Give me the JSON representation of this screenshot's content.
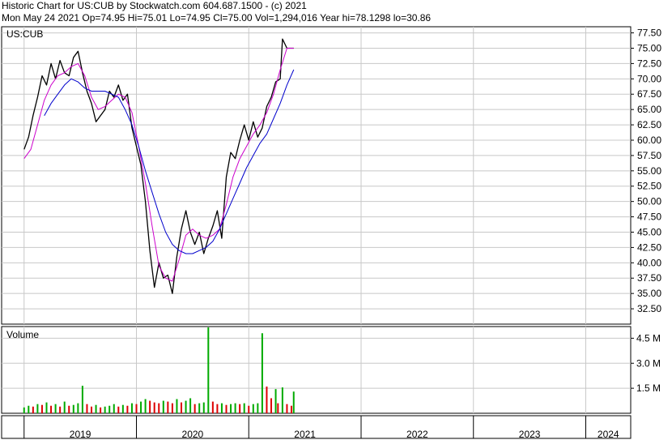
{
  "header": {
    "line1": "Historic Chart for US:CUB by Stockwatch.com 604.687.1500 - (c) 2021",
    "line2": "Mon May 24 2021   Op=74.95   Hi=75.01   Lo=74.95   Cl=75.00   Vol=1,294,016   Year hi=78.1298   lo=30.86"
  },
  "colors": {
    "price": "#000000",
    "ma_short": "#cc00cc",
    "ma_long": "#0000cc",
    "vol_up": "#00aa00",
    "vol_down": "#dd0000",
    "grid": "#c8c8c8"
  },
  "chart_data": [
    {
      "type": "line",
      "label": "US:CUB",
      "y_ticks": [
        "77.50",
        "75.00",
        "72.50",
        "70.00",
        "67.50",
        "65.00",
        "62.50",
        "60.00",
        "57.50",
        "55.00",
        "52.50",
        "50.00",
        "47.50",
        "45.00",
        "42.50",
        "40.00",
        "37.50",
        "35.00",
        "32.50"
      ],
      "ylim": [
        30.0,
        78.5
      ],
      "x_ticks": [
        "2019",
        "2020",
        "2021",
        "2022",
        "2023",
        "2024"
      ],
      "series": [
        {
          "values": [
            [
              2019.0,
              58.5
            ],
            [
              2019.04,
              60.5
            ],
            [
              2019.08,
              64.0
            ],
            [
              2019.12,
              67.0
            ],
            [
              2019.16,
              70.5
            ],
            [
              2019.2,
              69.0
            ],
            [
              2019.24,
              72.5
            ],
            [
              2019.28,
              70.0
            ],
            [
              2019.32,
              73.0
            ],
            [
              2019.36,
              71.0
            ],
            [
              2019.4,
              70.5
            ],
            [
              2019.44,
              73.5
            ],
            [
              2019.48,
              74.5
            ],
            [
              2019.52,
              71.0
            ],
            [
              2019.56,
              68.0
            ],
            [
              2019.6,
              66.0
            ],
            [
              2019.64,
              63.0
            ],
            [
              2019.68,
              64.0
            ],
            [
              2019.72,
              65.0
            ],
            [
              2019.76,
              68.0
            ],
            [
              2019.8,
              67.0
            ],
            [
              2019.84,
              69.0
            ],
            [
              2019.88,
              66.5
            ],
            [
              2019.92,
              67.5
            ],
            [
              2019.96,
              62.0
            ],
            [
              2020.0,
              59.0
            ],
            [
              2020.04,
              56.0
            ],
            [
              2020.08,
              50.0
            ],
            [
              2020.12,
              42.0
            ],
            [
              2020.16,
              36.0
            ],
            [
              2020.2,
              40.0
            ],
            [
              2020.24,
              37.5
            ],
            [
              2020.28,
              38.0
            ],
            [
              2020.32,
              35.0
            ],
            [
              2020.36,
              41.0
            ],
            [
              2020.4,
              45.5
            ],
            [
              2020.44,
              48.5
            ],
            [
              2020.48,
              45.0
            ],
            [
              2020.52,
              43.0
            ],
            [
              2020.56,
              45.0
            ],
            [
              2020.6,
              41.5
            ],
            [
              2020.64,
              44.0
            ],
            [
              2020.68,
              46.0
            ],
            [
              2020.72,
              48.5
            ],
            [
              2020.76,
              44.0
            ],
            [
              2020.8,
              54.0
            ],
            [
              2020.84,
              58.0
            ],
            [
              2020.88,
              57.0
            ],
            [
              2020.92,
              60.0
            ],
            [
              2020.96,
              62.5
            ],
            [
              2021.0,
              60.0
            ],
            [
              2021.04,
              63.0
            ],
            [
              2021.08,
              60.5
            ],
            [
              2021.12,
              62.0
            ],
            [
              2021.16,
              65.5
            ],
            [
              2021.2,
              67.0
            ],
            [
              2021.24,
              69.5
            ],
            [
              2021.28,
              70.0
            ],
            [
              2021.3,
              76.5
            ],
            [
              2021.34,
              75.0
            ],
            [
              2021.38,
              75.0
            ],
            [
              2021.4,
              75.0
            ]
          ]
        },
        {
          "name": "",
          "values": [
            [
              2019.0,
              57.0
            ],
            [
              2019.06,
              58.5
            ],
            [
              2019.12,
              62.5
            ],
            [
              2019.18,
              66.5
            ],
            [
              2019.24,
              69.0
            ],
            [
              2019.3,
              70.5
            ],
            [
              2019.36,
              71.0
            ],
            [
              2019.42,
              72.0
            ],
            [
              2019.48,
              72.5
            ],
            [
              2019.54,
              70.5
            ],
            [
              2019.6,
              67.0
            ],
            [
              2019.66,
              65.0
            ],
            [
              2019.72,
              65.5
            ],
            [
              2019.78,
              66.5
            ],
            [
              2019.84,
              67.5
            ],
            [
              2019.9,
              67.0
            ],
            [
              2019.96,
              64.5
            ],
            [
              2020.02,
              59.0
            ],
            [
              2020.08,
              53.0
            ],
            [
              2020.14,
              46.0
            ],
            [
              2020.2,
              39.5
            ],
            [
              2020.26,
              37.5
            ],
            [
              2020.32,
              37.0
            ],
            [
              2020.38,
              40.5
            ],
            [
              2020.44,
              44.5
            ],
            [
              2020.5,
              45.5
            ],
            [
              2020.56,
              44.5
            ],
            [
              2020.62,
              44.0
            ],
            [
              2020.68,
              44.5
            ],
            [
              2020.74,
              45.5
            ],
            [
              2020.8,
              49.5
            ],
            [
              2020.86,
              54.0
            ],
            [
              2020.92,
              57.0
            ],
            [
              2020.98,
              59.0
            ],
            [
              2021.04,
              61.0
            ],
            [
              2021.1,
              62.5
            ],
            [
              2021.16,
              64.5
            ],
            [
              2021.22,
              67.5
            ],
            [
              2021.28,
              71.5
            ],
            [
              2021.34,
              75.0
            ],
            [
              2021.4,
              75.0
            ]
          ]
        },
        {
          "name": "",
          "values": [
            [
              2019.18,
              64.0
            ],
            [
              2019.24,
              66.0
            ],
            [
              2019.3,
              67.5
            ],
            [
              2019.36,
              69.0
            ],
            [
              2019.42,
              70.0
            ],
            [
              2019.48,
              69.5
            ],
            [
              2019.54,
              68.5
            ],
            [
              2019.6,
              68.0
            ],
            [
              2019.66,
              68.0
            ],
            [
              2019.72,
              68.0
            ],
            [
              2019.78,
              67.5
            ],
            [
              2019.84,
              67.0
            ],
            [
              2019.9,
              65.0
            ],
            [
              2019.96,
              62.5
            ],
            [
              2020.02,
              59.0
            ],
            [
              2020.08,
              55.0
            ],
            [
              2020.14,
              51.5
            ],
            [
              2020.2,
              48.0
            ],
            [
              2020.26,
              45.0
            ],
            [
              2020.32,
              43.0
            ],
            [
              2020.38,
              42.0
            ],
            [
              2020.44,
              41.5
            ],
            [
              2020.5,
              41.5
            ],
            [
              2020.56,
              42.0
            ],
            [
              2020.62,
              42.5
            ],
            [
              2020.68,
              43.5
            ],
            [
              2020.74,
              45.5
            ],
            [
              2020.8,
              48.0
            ],
            [
              2020.86,
              50.5
            ],
            [
              2020.92,
              53.0
            ],
            [
              2020.98,
              55.5
            ],
            [
              2021.04,
              57.5
            ],
            [
              2021.1,
              59.5
            ],
            [
              2021.16,
              61.0
            ],
            [
              2021.22,
              63.5
            ],
            [
              2021.28,
              66.0
            ],
            [
              2021.34,
              69.0
            ],
            [
              2021.4,
              71.5
            ]
          ]
        }
      ]
    },
    {
      "type": "bar",
      "label": "Volume",
      "y_ticks": [
        "4.5 M",
        "3.0 M",
        "1.5 M"
      ],
      "ylim": [
        0,
        5.2
      ],
      "x_ticks": [
        "2019",
        "2020",
        "2021",
        "2022",
        "2023",
        "2024"
      ],
      "values": [
        [
          2019.0,
          0.35
        ],
        [
          2019.04,
          0.45
        ],
        [
          2019.08,
          0.4
        ],
        [
          2019.12,
          0.55
        ],
        [
          2019.16,
          0.5
        ],
        [
          2019.2,
          0.65
        ],
        [
          2019.24,
          0.45
        ],
        [
          2019.28,
          0.55
        ],
        [
          2019.32,
          0.4
        ],
        [
          2019.36,
          0.7
        ],
        [
          2019.4,
          0.45
        ],
        [
          2019.44,
          0.5
        ],
        [
          2019.48,
          0.6
        ],
        [
          2019.52,
          1.65
        ],
        [
          2019.56,
          0.55
        ],
        [
          2019.6,
          0.4
        ],
        [
          2019.64,
          0.5
        ],
        [
          2019.68,
          0.35
        ],
        [
          2019.72,
          0.4
        ],
        [
          2019.76,
          0.45
        ],
        [
          2019.8,
          0.55
        ],
        [
          2019.84,
          0.4
        ],
        [
          2019.88,
          0.5
        ],
        [
          2019.92,
          0.45
        ],
        [
          2019.96,
          0.6
        ],
        [
          2020.0,
          0.55
        ],
        [
          2020.04,
          0.7
        ],
        [
          2020.08,
          0.85
        ],
        [
          2020.12,
          0.75
        ],
        [
          2020.16,
          0.65
        ],
        [
          2020.2,
          0.6
        ],
        [
          2020.24,
          0.75
        ],
        [
          2020.28,
          0.7
        ],
        [
          2020.32,
          0.6
        ],
        [
          2020.36,
          0.85
        ],
        [
          2020.4,
          0.65
        ],
        [
          2020.44,
          0.75
        ],
        [
          2020.48,
          0.9
        ],
        [
          2020.52,
          0.55
        ],
        [
          2020.56,
          0.6
        ],
        [
          2020.6,
          0.65
        ],
        [
          2020.64,
          5.15
        ],
        [
          2020.68,
          0.7
        ],
        [
          2020.72,
          0.55
        ],
        [
          2020.76,
          0.6
        ],
        [
          2020.8,
          0.5
        ],
        [
          2020.84,
          0.55
        ],
        [
          2020.88,
          0.6
        ],
        [
          2020.92,
          0.55
        ],
        [
          2020.96,
          0.6
        ],
        [
          2021.0,
          0.45
        ],
        [
          2021.04,
          0.55
        ],
        [
          2021.08,
          0.6
        ],
        [
          2021.12,
          4.8
        ],
        [
          2021.16,
          1.6
        ],
        [
          2021.2,
          0.9
        ],
        [
          2021.24,
          1.45
        ],
        [
          2021.26,
          0.6
        ],
        [
          2021.3,
          1.55
        ],
        [
          2021.34,
          0.55
        ],
        [
          2021.38,
          0.45
        ],
        [
          2021.4,
          1.3
        ]
      ]
    }
  ]
}
